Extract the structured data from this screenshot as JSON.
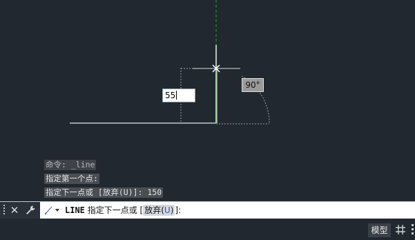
{
  "dynamic_input": {
    "length_value": "55",
    "angle_value": "90°"
  },
  "history": [
    "命令: _line",
    "指定第一个点:",
    "指定下一点或 [放弃(U)]: 150"
  ],
  "command_line": {
    "command_name": "LINE",
    "prompt_text": "指定下一点或 [",
    "option_label_prefix": "放弃(",
    "option_key": "U",
    "option_label_suffix": ")",
    "prompt_end": "]:"
  },
  "status_bar": {
    "model_tab_label": "模型"
  },
  "icons": {
    "close": "close-icon",
    "customize": "wrench-icon",
    "grid": "grid-icon",
    "more": "more-icon",
    "prompt": "command-prompt-icon"
  },
  "colors": {
    "canvas_bg": "#212830",
    "drawn_line": "#c8c8c8",
    "rubber_band": "#ffffff",
    "y_axis": "#2e9e2e",
    "snap_tracking": "#9aa0a6"
  }
}
